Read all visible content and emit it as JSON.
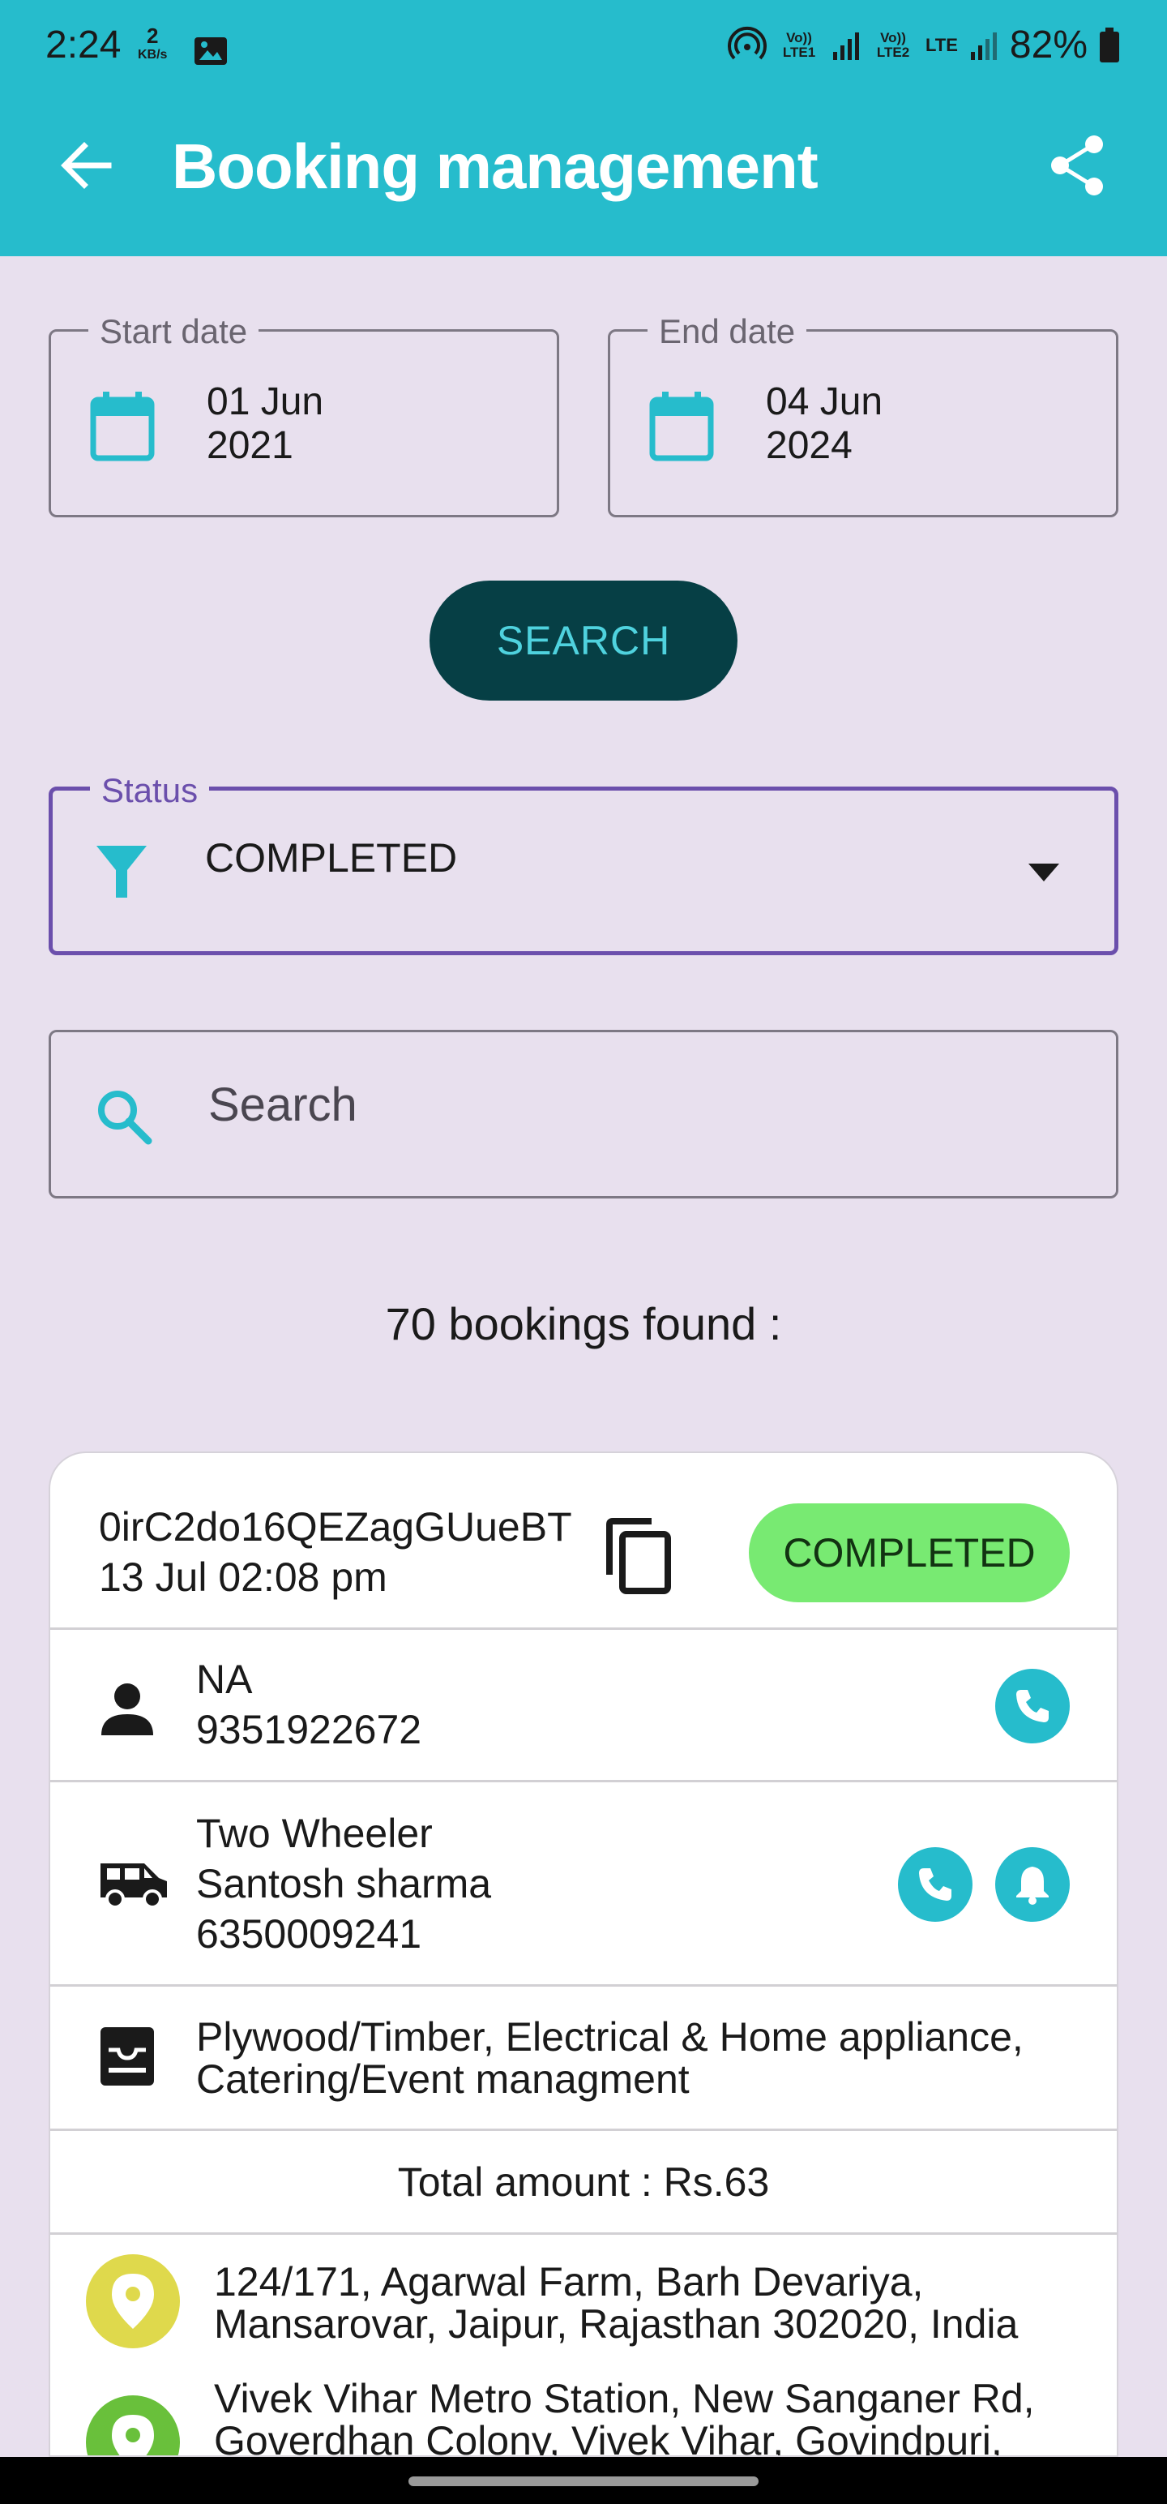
{
  "status_bar": {
    "time": "2:24",
    "net_speed_value": "2",
    "net_speed_unit": "KB/s",
    "sim1_label": "Vo)) LTE1",
    "sim2_label": "Vo)) LTE2",
    "sim2_tech": "LTE",
    "battery": "82%"
  },
  "app_bar": {
    "title": "Booking management",
    "back_icon": "arrow-left-icon",
    "share_icon": "share-icon"
  },
  "filters": {
    "start_date": {
      "label": "Start date",
      "value_line1": "01 Jun",
      "value_line2": "2021"
    },
    "end_date": {
      "label": "End date",
      "value_line1": "04 Jun",
      "value_line2": "2024"
    },
    "search_button": "SEARCH",
    "status": {
      "label": "Status",
      "value": "COMPLETED"
    },
    "search": {
      "placeholder": "Search"
    }
  },
  "results": {
    "count_text": "70 bookings found :"
  },
  "booking": {
    "id": "0irC2do16QEZagGUueBT",
    "datetime": "13 Jul 02:08 pm",
    "status": "COMPLETED",
    "customer": {
      "name": "NA",
      "phone": "9351922672"
    },
    "vehicle": {
      "type": "Two Wheeler",
      "driver": "Santosh  sharma",
      "phone": "6350009241"
    },
    "goods": {
      "line1": "Plywood/Timber, Electrical & Home appliance,",
      "line2": "Catering/Event managment"
    },
    "total": "Total amount : Rs.63",
    "pickup": {
      "line1": "124/171, Agarwal Farm, Barh Devariya,",
      "line2": "Mansarovar, Jaipur, Rajasthan 302020, India"
    },
    "drop": {
      "line1": "Vivek Vihar Metro Station, New Sanganer Rd,",
      "line2": "Goverdhan Colony, Vivek Vihar, Govindpuri,"
    }
  },
  "colors": {
    "primary": "#26bccc",
    "background": "#e8e0ee",
    "search_button": "#063f45",
    "status_outline": "#6b4fac",
    "completed_pill": "#78ea72",
    "pickup_pin": "#dfd94c",
    "drop_pin": "#69c03b"
  }
}
